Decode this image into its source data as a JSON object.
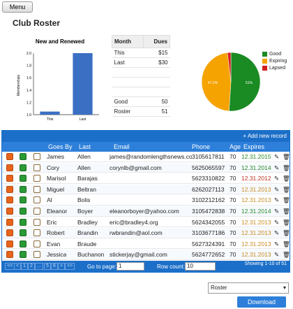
{
  "menu_label": "Menu",
  "page_title": "Club Roster",
  "bar_chart": {
    "title": "New and Renewed",
    "ylabel": "Memberships",
    "categories": [
      "This",
      "Last"
    ],
    "values": [
      1.05,
      2.0
    ],
    "ylim": [
      1.0,
      2.0
    ],
    "ticks": [
      "2.0",
      "1.8",
      "1.6",
      "1.4",
      "1.2",
      "1.0"
    ]
  },
  "dues_table": {
    "headers": [
      "Month",
      "Dues"
    ],
    "rows": [
      [
        "This",
        "$15"
      ],
      [
        "Last",
        "$30"
      ],
      [
        "",
        ""
      ],
      [
        "",
        ""
      ],
      [
        "",
        ""
      ],
      [
        "Good",
        "50"
      ],
      [
        "Roster",
        "51"
      ]
    ]
  },
  "pie": {
    "legend": [
      "Good",
      "Expiring",
      "Lapsed"
    ],
    "colors": [
      "#1a8a22",
      "#f5a300",
      "#d42020"
    ],
    "values": [
      51,
      47.1,
      1.9
    ],
    "labels": [
      "51%",
      "47.1%"
    ]
  },
  "grid": {
    "add_label": "+ Add new record",
    "columns": [
      "Goes By",
      "Last",
      "Email",
      "Phone",
      "Age",
      "Expires"
    ],
    "rows": [
      {
        "goes": "James",
        "last": "Allen",
        "email": "james@randomlengthsnews.com",
        "phone": "3105617811",
        "age": "70",
        "exp": "12.31.2015",
        "c": "green"
      },
      {
        "goes": "Cory",
        "last": "Allen",
        "email": "corynlb@gmail.com",
        "phone": "5625065597",
        "age": "70",
        "exp": "12.31.2014",
        "c": "green"
      },
      {
        "goes": "Marisol",
        "last": "Barajas",
        "email": "",
        "phone": "5623310822",
        "age": "70",
        "exp": "12.31.2012",
        "c": "red"
      },
      {
        "goes": "Miguel",
        "last": "Beltran",
        "email": "",
        "phone": "6262027113",
        "age": "70",
        "exp": "12.31.2013",
        "c": "orange"
      },
      {
        "goes": "Al",
        "last": "Bolis",
        "email": "",
        "phone": "3102212162",
        "age": "70",
        "exp": "12.31.2013",
        "c": "orange"
      },
      {
        "goes": "Eleanor",
        "last": "Boyer",
        "email": "eleanorboyer@yahoo.com",
        "phone": "3105472838",
        "age": "70",
        "exp": "12.31.2014",
        "c": "green"
      },
      {
        "goes": "Eric",
        "last": "Bradley",
        "email": "eric@bradley4.org",
        "phone": "5624342055",
        "age": "70",
        "exp": "12.31.2013",
        "c": "orange"
      },
      {
        "goes": "Robert",
        "last": "Brandin",
        "email": "rwbrandin@aol.com",
        "phone": "3103677186",
        "age": "70",
        "exp": "12.31.2013",
        "c": "orange"
      },
      {
        "goes": "Evan",
        "last": "Braude",
        "email": "",
        "phone": "5627324391",
        "age": "70",
        "exp": "12.31.2013",
        "c": "orange"
      },
      {
        "goes": "Jessica",
        "last": "Buchanon",
        "email": "stickerjay@gmail.com",
        "phone": "5624772652",
        "age": "70",
        "exp": "12.31.2013",
        "c": "orange"
      }
    ],
    "pager": [
      "<<",
      "<",
      "1",
      "2",
      "...",
      "5",
      "6",
      ">",
      ">>"
    ],
    "goto_label": "Go to page:",
    "goto_value": "1",
    "rowcount_label": "Row count:",
    "rowcount_value": "10",
    "showing": "Showing 1-10 of 51"
  },
  "roster_select": "Roster",
  "download_label": "Download"
}
